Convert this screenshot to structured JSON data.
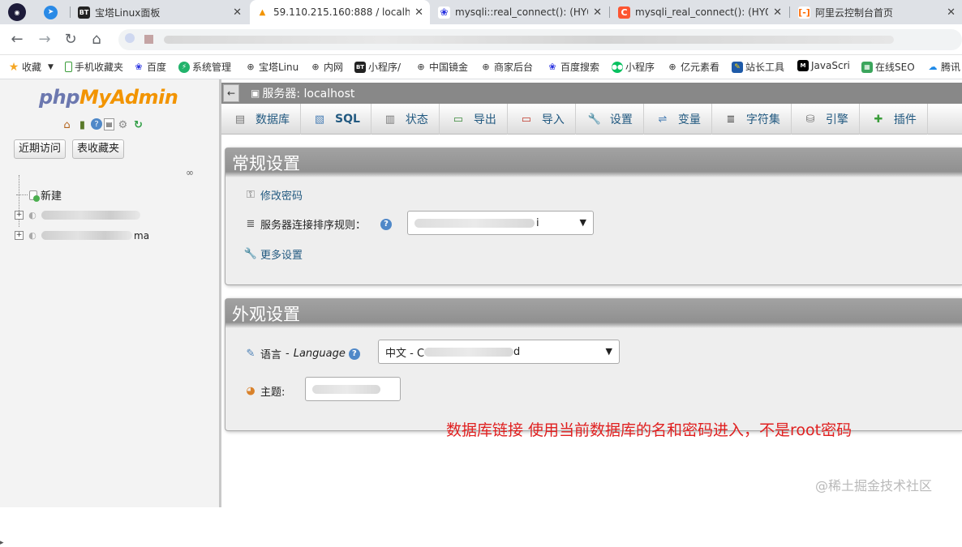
{
  "tabs": [
    {
      "label": "",
      "icon": "chromium-icon"
    },
    {
      "label": "",
      "icon": "telegram-icon"
    },
    {
      "label": "宝塔Linux面板",
      "icon": "bt-icon"
    },
    {
      "label": "59.110.215.160:888 / localh",
      "icon": "pma-icon"
    },
    {
      "label": "mysqli::real_connect(): (HY0",
      "icon": "baidu-icon"
    },
    {
      "label": "mysqli_real_connect(): (HY0",
      "icon": "csdn-icon"
    },
    {
      "label": "阿里云控制台首页",
      "icon": "aliyun-icon"
    }
  ],
  "bookmarks": [
    {
      "label": "收藏",
      "icon": "star-icon"
    },
    {
      "label": "手机收藏夹",
      "icon": "phone-icon"
    },
    {
      "label": "百度",
      "icon": "baidu-paw-icon"
    },
    {
      "label": "系统管理",
      "icon": "system-icon"
    },
    {
      "label": "宝塔Linu",
      "icon": "globe-icon"
    },
    {
      "label": "内网",
      "icon": "globe-icon"
    },
    {
      "label": "小程序/",
      "icon": "bt-icon"
    },
    {
      "label": "中国镜金",
      "icon": "globe-icon"
    },
    {
      "label": "商家后台",
      "icon": "globe-icon"
    },
    {
      "label": "百度搜索",
      "icon": "baidu-paw-icon"
    },
    {
      "label": "小程序",
      "icon": "wechat-icon"
    },
    {
      "label": "亿元素看",
      "icon": "globe-icon"
    },
    {
      "label": "站长工具",
      "icon": "tool-icon"
    },
    {
      "label": "JavaScri",
      "icon": "js-icon"
    },
    {
      "label": "在线SEO",
      "icon": "seo-icon"
    },
    {
      "label": "腾讯",
      "icon": "cloud-icon"
    }
  ],
  "left": {
    "logo_php": "php",
    "logo_myadmin": "MyAdmin",
    "recent_button": "近期访问",
    "favorites_button": "表收藏夹",
    "tree_new": "新建",
    "tree_db2_suffix": "ma"
  },
  "right": {
    "server": "服务器: localhost",
    "menu": [
      {
        "label": "数据库",
        "icon": "database-icon"
      },
      {
        "label": "SQL",
        "icon": "sql-icon"
      },
      {
        "label": "状态",
        "icon": "status-icon"
      },
      {
        "label": "导出",
        "icon": "export-icon"
      },
      {
        "label": "导入",
        "icon": "import-icon"
      },
      {
        "label": "设置",
        "icon": "wrench-icon"
      },
      {
        "label": "变量",
        "icon": "variables-icon"
      },
      {
        "label": "字符集",
        "icon": "charset-icon"
      },
      {
        "label": "引擎",
        "icon": "engine-icon"
      },
      {
        "label": "插件",
        "icon": "plugin-icon"
      }
    ],
    "general": {
      "title": "常规设置",
      "change_password": "修改密码",
      "collation_label": "服务器连接排序规则：",
      "collation_value_suffix": "i",
      "more_settings": "更多设置"
    },
    "appearance": {
      "title": "外观设置",
      "language_label": "语言",
      "language_label_en": "Language",
      "language_value_prefix": "中文 - C",
      "language_value_suffix": "d",
      "theme_label": "主题:"
    }
  },
  "annotation": "数据库链接 使用当前数据库的名和密码进入，不是root密码",
  "watermark": "@稀土掘金技术社区"
}
